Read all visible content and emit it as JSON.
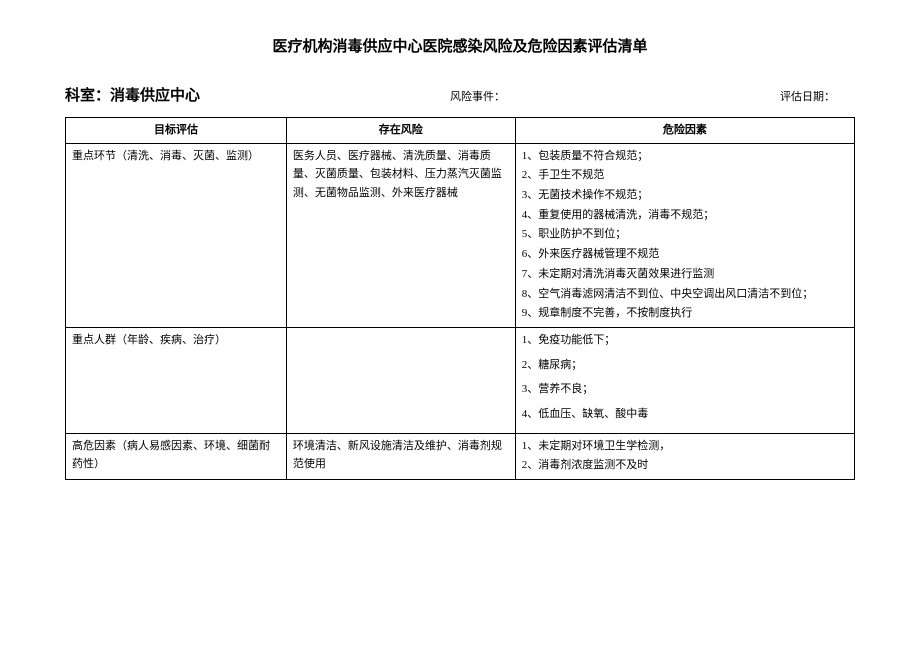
{
  "title": "医疗机构消毒供应中心医院感染风险及危险因素评估清单",
  "header": {
    "dept_label": "科室：消毒供应中心",
    "event_label": "风险事件：",
    "date_label": "评估日期："
  },
  "table": {
    "headers": {
      "col1": "目标评估",
      "col2": "存在风险",
      "col3": "危险因素"
    },
    "rows": [
      {
        "target": "重点环节（清洗、消毒、灭菌、监测）",
        "risk": "医务人员、医疗器械、清洗质量、消毒质量、灭菌质量、包装材料、压力蒸汽灭菌监测、无菌物品监测、外来医疗器械",
        "factors": [
          "1、包装质量不符合规范；",
          "2、手卫生不规范",
          "3、无菌技术操作不规范；",
          "4、重复使用的器械清洗，消毒不规范；",
          "5、职业防护不到位；",
          "6、外来医疗器械管理不规范",
          "7、未定期对清洗消毒灭菌效果进行监测",
          "8、空气消毒滤网清洁不到位、中央空调出风口清洁不到位；",
          "9、规章制度不完善，不按制度执行"
        ]
      },
      {
        "target": "重点人群（年龄、疾病、治疗）",
        "risk": "",
        "factors": [
          "1、免疫功能低下；",
          "2、糖尿病；",
          "3、营养不良；",
          "4、低血压、缺氧、酸中毒"
        ]
      },
      {
        "target": "高危因素（病人易感因素、环境、细菌耐药性）",
        "risk": "环境清洁、新风设施清洁及维护、消毒剂规范使用",
        "factors": [
          "1、未定期对环境卫生学检测，",
          "2、消毒剂浓度监测不及时"
        ]
      }
    ]
  }
}
